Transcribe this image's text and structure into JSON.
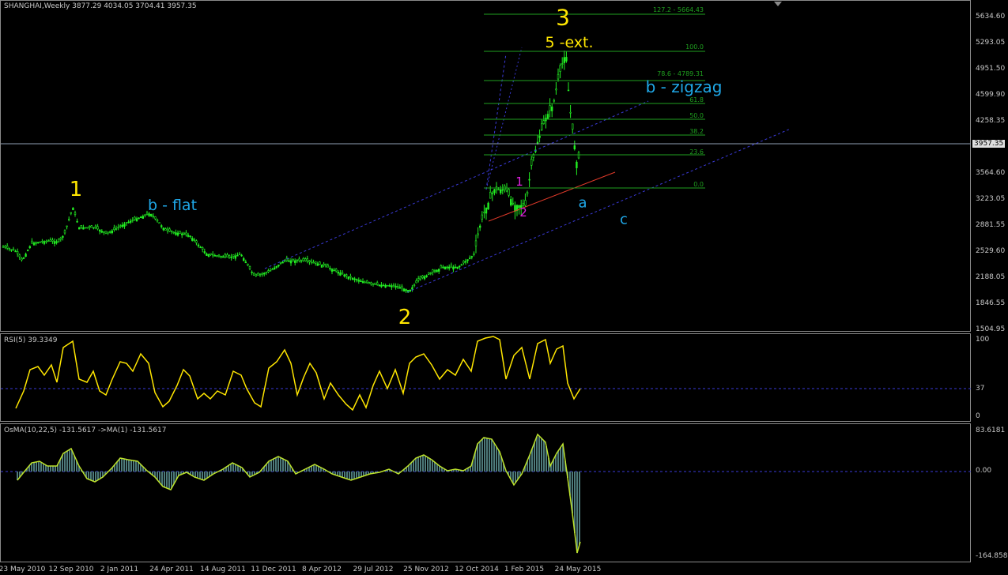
{
  "window": {
    "header": "SHANGHAI,Weekly  3877.29 4034.05 3704.41 3957.35",
    "last_price": "3957.35"
  },
  "price_axis": {
    "ticks": [
      "5634.60",
      "5293.05",
      "4951.50",
      "4599.90",
      "4258.35",
      "3564.60",
      "3223.05",
      "2881.55",
      "2529.60",
      "2188.05",
      "1846.55",
      "1504.95"
    ]
  },
  "rsi": {
    "header": "RSI(5) 39.3349",
    "ticks": [
      "100",
      "37",
      "0"
    ],
    "level": 37
  },
  "osma": {
    "header": "OsMA(10,22,5) -131.5617   ->MA(1) -131.5617",
    "ticks": [
      "83.6181",
      "0.00",
      "-164.8589"
    ]
  },
  "fibonacci": {
    "levels": [
      {
        "label": "127.2 - 5664.43",
        "price": 5664.43
      },
      {
        "label": "100.0",
        "price": 5178
      },
      {
        "label": "78.6 - 4789.31",
        "price": 4789.31
      },
      {
        "label": "61.8",
        "price": 4489
      },
      {
        "label": "50.0",
        "price": 4278
      },
      {
        "label": "38.2",
        "price": 4067
      },
      {
        "label": "23.6",
        "price": 3806
      },
      {
        "label": "0.0",
        "price": 3373
      }
    ]
  },
  "wave_labels": {
    "w1": "1",
    "w2": "2",
    "w3": "3",
    "w5ext": "5 -ext.",
    "b_flat": "b - flat",
    "b_zigzag": "b - zigzag",
    "a": "a",
    "c": "c",
    "sub1": "1",
    "sub2": "2"
  },
  "dates": [
    "23 May 2010",
    "12 Sep 2010",
    "2 Jan 2011",
    "24 Apr 2011",
    "14 Aug 2011",
    "11 Dec 2011",
    "8 Apr 2012",
    "29 Jul 2012",
    "25 Nov 2012",
    "12 Oct 2014",
    "1 Feb 2015",
    "24 May 2015"
  ],
  "colors": {
    "candles": "#22ee22",
    "rsi_line": "#ffe600",
    "osma_line": "#bde22b",
    "osma_hist": "#4d7a7a",
    "channel": "#3a3ad8",
    "fib": "#1fa01f",
    "support": "#e03a2a"
  }
}
